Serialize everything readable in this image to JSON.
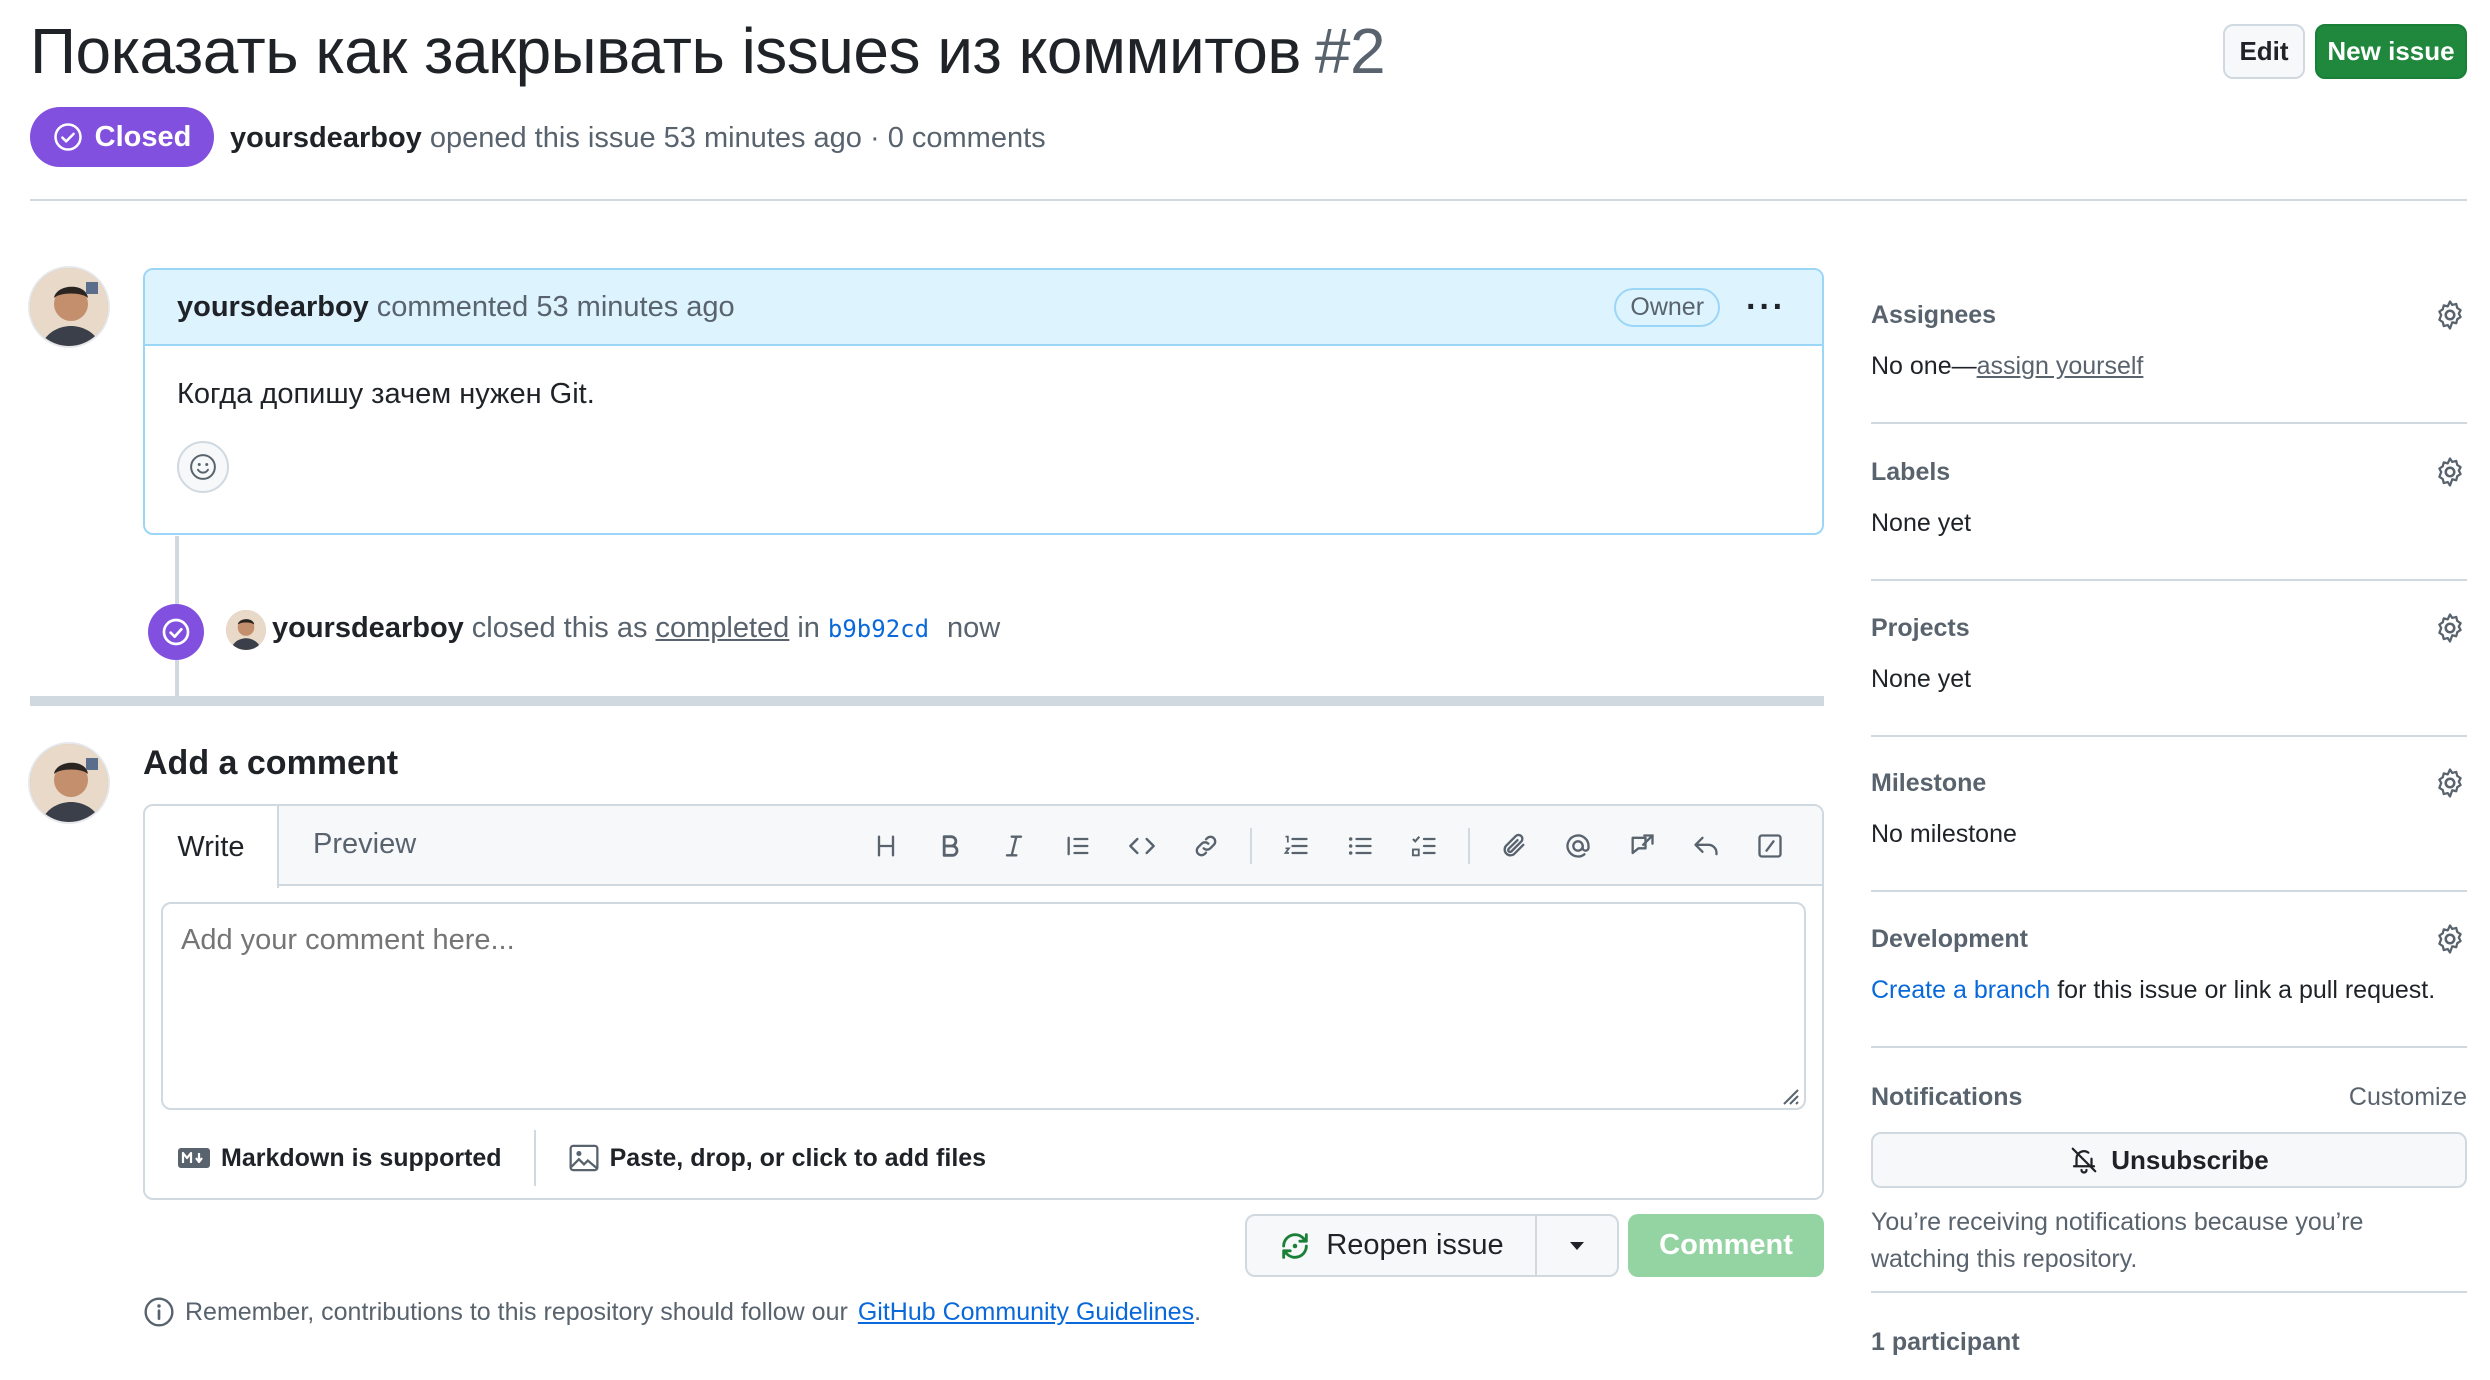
{
  "issue": {
    "title": "Показать как закрывать issues из коммитов",
    "number": "#2",
    "status": "Closed",
    "author": "yoursdearboy",
    "meta_rest": "opened this issue 53 minutes ago · 0 comments"
  },
  "header_buttons": {
    "edit": "Edit",
    "new_issue": "New issue"
  },
  "comment": {
    "author": "yoursdearboy",
    "action": "commented 53 minutes ago",
    "role_badge": "Owner",
    "body": "Когда допишу зачем нужен Git."
  },
  "event": {
    "author": "yoursdearboy",
    "pre": "closed this as",
    "link": "completed",
    "mid": "in",
    "commit": "b9b92cd",
    "time": "now"
  },
  "composer": {
    "title": "Add a comment",
    "tab_write": "Write",
    "tab_preview": "Preview",
    "placeholder": "Add your comment here...",
    "markdown_note": "Markdown is supported",
    "files_note": "Paste, drop, or click to add files",
    "reopen": "Reopen issue",
    "comment": "Comment",
    "remember_pre": "Remember, contributions to this repository should follow our",
    "remember_link": "GitHub Community Guidelines",
    "remember_post": "."
  },
  "sidebar": {
    "assignees": {
      "label": "Assignees",
      "value_pre": "No one—",
      "value_link": "assign yourself"
    },
    "labels": {
      "label": "Labels",
      "value": "None yet"
    },
    "projects": {
      "label": "Projects",
      "value": "None yet"
    },
    "milestone": {
      "label": "Milestone",
      "value": "No milestone"
    },
    "development": {
      "label": "Development",
      "value_link": "Create a branch",
      "value_post": " for this issue or link a pull request."
    },
    "notifications": {
      "label": "Notifications",
      "customize": "Customize",
      "unsubscribe": "Unsubscribe",
      "note": "You’re receiving notifications because you’re watching this repository."
    },
    "participants": "1 participant"
  },
  "colors": {
    "accent_green": "#1f883d",
    "closed_purple": "#8250df",
    "link_blue": "#0969da",
    "comment_header_bg": "#ddf4ff"
  }
}
